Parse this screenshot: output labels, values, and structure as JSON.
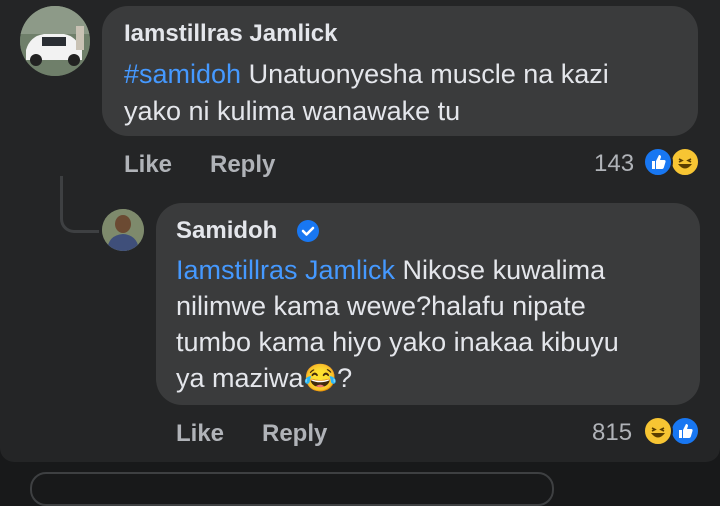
{
  "comment": {
    "author": "Iamstillras Jamlick",
    "hashtag": "#samidoh",
    "line1_rest": " Unatuonyesha muscle na kazi",
    "line2": "yako ni kulima wanawake tu",
    "like_label": "Like",
    "reply_label": "Reply",
    "reaction_count": "143",
    "reactions": [
      "like-icon",
      "haha-icon"
    ]
  },
  "reply": {
    "author": "Samidoh",
    "verified": true,
    "mention": "Iamstillras Jamlick",
    "line1_rest": " Nikose kuwalima",
    "line2": "nilimwe kama wewe?halafu nipate",
    "line3": "tumbo kama hiyo yako inakaa kibuyu",
    "line4": "ya maziwa😂?",
    "like_label": "Like",
    "reply_label": "Reply",
    "reaction_count": "815",
    "reactions": [
      "haha-icon",
      "like-icon"
    ]
  },
  "colors": {
    "background": "#242526",
    "bubble": "#3a3b3c",
    "text": "#e4e6eb",
    "secondary": "#b0b3b8",
    "mention": "#4599ff",
    "like_blue": "#1877f2",
    "haha_yellow": "#f7c533"
  }
}
